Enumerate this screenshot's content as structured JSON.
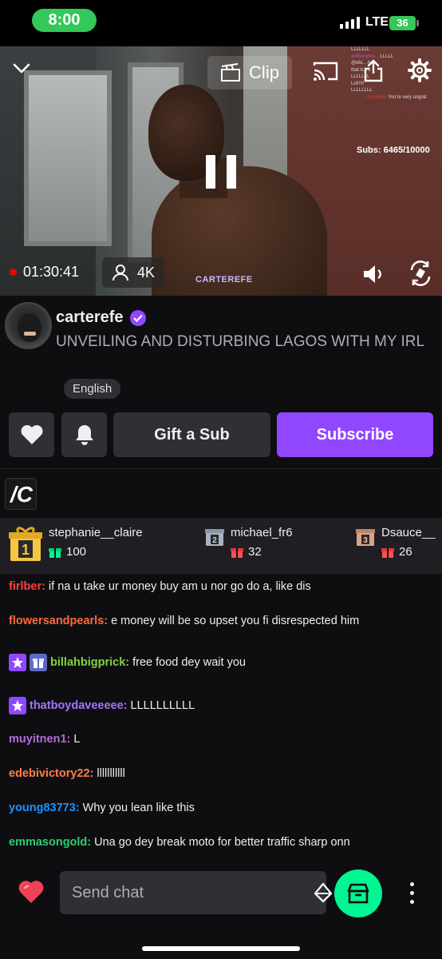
{
  "status_bar": {
    "time": "8:00",
    "network": "LTE",
    "battery": "36"
  },
  "video": {
    "clip_label": "Clip",
    "overlay_chat": [
      {
        "user": "",
        "text": "LLLLLLL"
      },
      {
        "user": "anthonymo...",
        "text": "LLLLL"
      },
      {
        "user": "",
        "text": "@ebi... Ast"
      },
      {
        "user": "",
        "text": "that b... it"
      },
      {
        "user": "",
        "text": "LLLLLLL"
      },
      {
        "user": "",
        "text": "Lol!!!!!"
      },
      {
        "user": "",
        "text": "LLLLLLLL"
      },
      {
        "user": "ormaliom",
        "text": "You're very ungrat"
      }
    ],
    "subs_counter": "Subs: 6465/10000",
    "uptime": "01:30:41",
    "viewers": "4K",
    "watermark": "CARTEREFE"
  },
  "channel": {
    "name": "carterefe",
    "title": "UNVEILING AND DISTURBING LAGOS WITH MY IRL",
    "language": "English"
  },
  "actions": {
    "gift_label": "Gift a Sub",
    "subscribe_label": "Subscribe"
  },
  "leaderboard": [
    {
      "rank": "1",
      "name": "stephanie__claire",
      "count": "100"
    },
    {
      "rank": "2",
      "name": "michael_fr6",
      "count": "32"
    },
    {
      "rank": "3",
      "name": "Dsauce__",
      "count": "26"
    }
  ],
  "chat": [
    {
      "user": "firlber:",
      "text": "if na u take ur money buy am u nor go do a, like dis",
      "color": "#ff3f3f"
    },
    {
      "user": "flowersandpearls:",
      "text": "e money will be so upset you fi disrespected him",
      "color": "#ff6a3d"
    },
    {
      "user": "billahbigprick:",
      "text": "free food dey wait you",
      "color": "#7fd43c"
    },
    {
      "user": "thatboydaveeeee:",
      "text": "LLLLLLLLLL",
      "color": "#a970ff"
    },
    {
      "user": "muyitnen1:",
      "text": "L",
      "color": "#b26bd9"
    },
    {
      "user": "edebivictory22:",
      "text": "lllllllllll",
      "color": "#ff7f50"
    },
    {
      "user": "young83773:",
      "text": "Why you lean like this",
      "color": "#1e90ff"
    },
    {
      "user": "emmasongold:",
      "text": "Una go dey break moto for better traffic sharp onn",
      "color": "#2ecc71"
    }
  ],
  "chat_input": {
    "placeholder": "Send chat"
  },
  "colors": {
    "accent": "#9147ff",
    "store": "#00f593",
    "live": "#eb0400"
  }
}
